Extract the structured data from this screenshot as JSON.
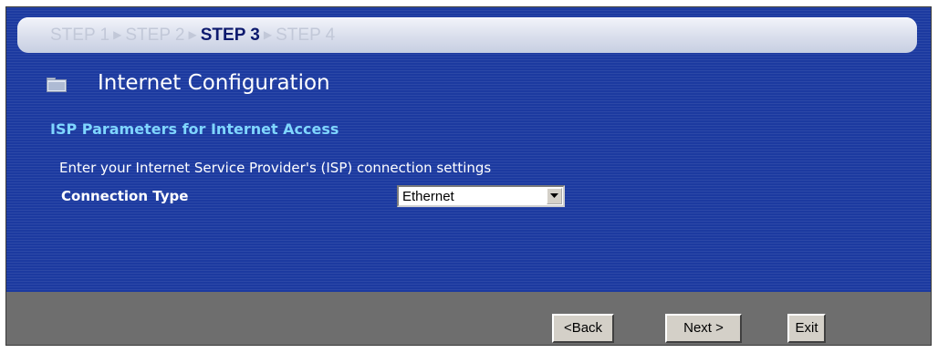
{
  "wizard": {
    "steps": [
      {
        "label": "STEP 1",
        "state": "inactive"
      },
      {
        "label": "STEP 2",
        "state": "inactive"
      },
      {
        "label": "STEP 3",
        "state": "current"
      },
      {
        "label": "STEP 4",
        "state": "inactive"
      }
    ]
  },
  "page": {
    "title": "Internet Configuration",
    "icon": "folder-icon"
  },
  "section": {
    "title": "ISP Parameters for Internet Access",
    "description": "Enter your Internet Service Provider's (ISP) connection settings"
  },
  "form": {
    "connection_type_label": "Connection Type",
    "connection_type_value": "Ethernet"
  },
  "buttons": {
    "back": "<Back",
    "next": "Next >",
    "exit": "Exit"
  },
  "colors": {
    "panel_bg": "#1c3aa0",
    "section_title": "#7fd6ff",
    "current_step": "#0d1a6e",
    "inactive_step": "#c2c8d8",
    "footer_bg": "#6e6e6e"
  }
}
